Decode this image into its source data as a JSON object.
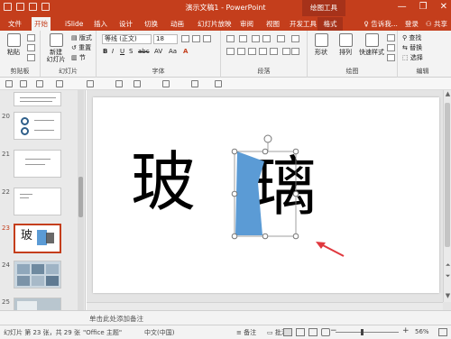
{
  "titlebar": {
    "doc_title": "演示文稿1 - PowerPoint",
    "context_title": "绘图工具",
    "win_min": "—",
    "win_restore": "❐",
    "win_close": "✕"
  },
  "tabs": {
    "items": [
      "文件",
      "开始",
      "iSlide",
      "插入",
      "设计",
      "切换",
      "动画",
      "幻灯片放映",
      "审阅",
      "视图",
      "开发工具",
      "格式"
    ],
    "active": "开始",
    "tell_me": "告诉我...",
    "login": "登录",
    "share": "共享"
  },
  "ribbon": {
    "clipboard": {
      "label": "剪贴板",
      "paste": "粘贴"
    },
    "slides": {
      "label": "幻灯片",
      "new_slide": "新建\n幻灯片",
      "layout": "版式",
      "reset": "重置",
      "section": "节"
    },
    "font": {
      "label": "字体",
      "font_name": "等线 (正文)",
      "font_size": "18"
    },
    "paragraph": {
      "label": "段落"
    },
    "drawing": {
      "label": "绘图",
      "shapes": "形状",
      "arrange": "排列",
      "quick_styles": "快速样式"
    },
    "editing": {
      "label": "编辑",
      "find": "查找",
      "replace": "替换",
      "select": "选择"
    }
  },
  "panel": {
    "slides": [
      {
        "num": ""
      },
      {
        "num": "20"
      },
      {
        "num": "21"
      },
      {
        "num": "22"
      },
      {
        "num": "23",
        "selected": true,
        "text": "玻"
      },
      {
        "num": "24"
      },
      {
        "num": "25"
      }
    ]
  },
  "slide": {
    "char_left": "玻",
    "char_right": "璃"
  },
  "notes": {
    "placeholder": "单击此处添加备注"
  },
  "status": {
    "slide_info": "幻灯片 第 23 张，共 29 张",
    "theme": "\"Office 主题\"",
    "language": "中文(中国)",
    "notes_btn": "备注",
    "comments_btn": "批注",
    "zoom_minus": "−",
    "zoom_plus": "+",
    "zoom": "56%"
  },
  "colors": {
    "accent": "#c43e1c",
    "shape_fill": "#5b9bd5",
    "arrow": "#e0383e"
  }
}
